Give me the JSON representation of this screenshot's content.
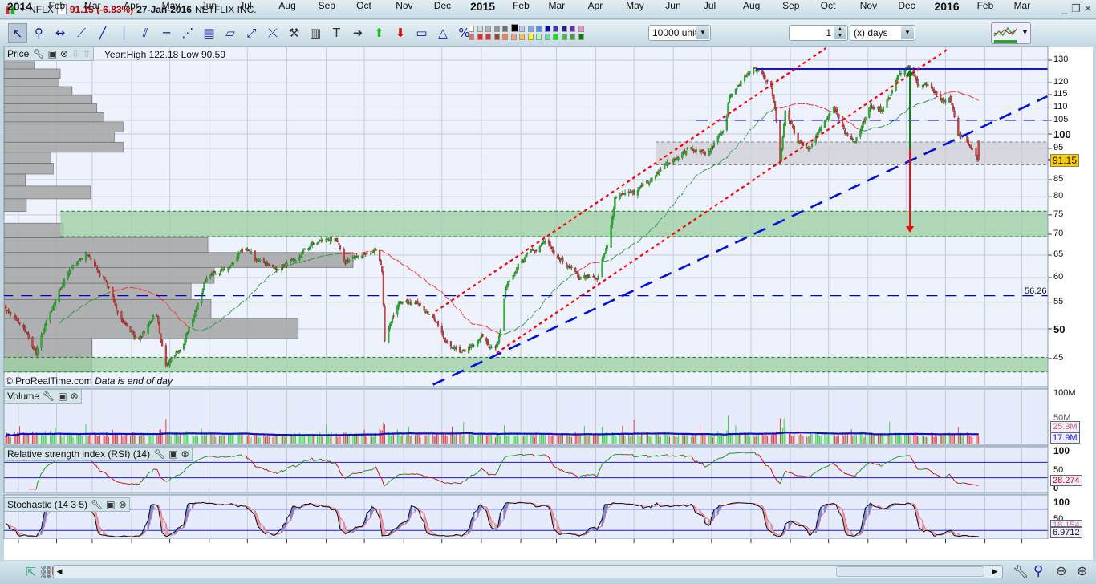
{
  "header": {
    "symbol": "NFLX",
    "price_change": "91.15 (-6.83%)",
    "date": "27-Jan-2016",
    "name": "NETFLIX INC."
  },
  "toolbar": {
    "tools": [
      [
        "pointer-icon",
        "↖"
      ],
      [
        "magnifier-icon",
        "⚲"
      ],
      [
        "horizontal-segment-icon",
        "↔"
      ],
      [
        "segment-icon",
        "⟋"
      ],
      [
        "line-icon",
        "╱"
      ],
      [
        "vertical-line-icon",
        "│"
      ],
      [
        "channel-icon",
        "⫽"
      ],
      [
        "horizontal-line-icon",
        "─"
      ],
      [
        "fan-icon",
        "⋰"
      ],
      [
        "fibonacci-icon",
        "▤"
      ],
      [
        "ruler-icon",
        "▱"
      ],
      [
        "point-line-icon",
        "⤢"
      ],
      [
        "cross-line-icon",
        "⤫"
      ],
      [
        "tools-icon",
        "⚒"
      ],
      [
        "trash-icon",
        "▥"
      ],
      [
        "text-icon",
        "T"
      ],
      [
        "arrow-right-icon",
        "➜"
      ],
      [
        "arrow-up-icon",
        "⬆"
      ],
      [
        "arrow-down-icon",
        "⬇"
      ],
      [
        "rectangle-icon",
        "▭"
      ],
      [
        "triangle-icon",
        "△"
      ],
      [
        "percent-icon",
        "%"
      ]
    ],
    "palette_top": [
      "#ffffff",
      "#d4d4d4",
      "#b4b4b4",
      "#949494",
      "#707070",
      "#000000",
      "#b8c8ff",
      "#80a8ff",
      "#4090ff",
      "#0000d0",
      "#3838b8",
      "#202090",
      "#8020c0",
      "#ff88c8"
    ],
    "palette_bottom": [
      "#e07070",
      "#ff2020",
      "#e03030",
      "#a04818",
      "#ff8040",
      "#ff9888",
      "#ffc040",
      "#ffff00",
      "#a8ffb0",
      "#60e0a0",
      "#00f000",
      "#40c040",
      "#40a040",
      "#008000"
    ],
    "units": "10000 units",
    "period_value": "1",
    "period_unit": "(x) days"
  },
  "price_panel": {
    "title": "Price",
    "info": "Year:High 122.18 Low 90.59",
    "copyright": "© ProRealTime.com",
    "disclaimer": "Data is end of day",
    "last_price_label": "91.15",
    "level_label": "56.26"
  },
  "volume_panel": {
    "title": "Volume",
    "ticks": [
      "100M",
      "50M"
    ],
    "last_label": "25.3M",
    "avg_label": "17.9M"
  },
  "rsi_panel": {
    "title": "Relative strength index (RSI) (14)",
    "ticks": [
      "100",
      "50",
      "0"
    ],
    "value_label": "28.274"
  },
  "stoch_panel": {
    "title": "Stochastic (14 3 5)",
    "ticks": [
      "100",
      "50"
    ],
    "k_label": "18.154",
    "d_label": "6.9712"
  },
  "colors": {
    "up": "#2fb52f",
    "down": "#c44848",
    "level": "#0000e0",
    "trend_red": "#ff0000",
    "zone_green": "#9fcfa6",
    "zone_grey": "#cfcfd4",
    "last_price_bg": "#ffcc00"
  },
  "chart_data": {
    "type": "candlestick",
    "symbol": "NFLX",
    "x_labels": [
      "2014",
      "Feb",
      "Mar",
      "Apr",
      "May",
      "Jun",
      "Jul",
      "Aug",
      "Sep",
      "Oct",
      "Nov",
      "Dec",
      "2015",
      "Feb",
      "Mar",
      "Apr",
      "May",
      "Jun",
      "Jul",
      "Aug",
      "Sep",
      "Oct",
      "Nov",
      "Dec",
      "2016",
      "Feb",
      "Mar"
    ],
    "y_ticks": [
      130,
      120,
      115,
      110,
      105,
      100,
      95,
      85,
      80,
      75,
      70,
      65,
      60,
      55,
      50,
      45
    ],
    "y_scale": "log",
    "ylim": [
      41,
      133
    ],
    "close_anchors": [
      [
        "2013-12-23",
        54
      ],
      [
        "2014-01-06",
        50
      ],
      [
        "2014-01-16",
        46
      ],
      [
        "2014-01-25",
        52
      ],
      [
        "2014-02-07",
        60
      ],
      [
        "2014-02-24",
        65
      ],
      [
        "2014-03-10",
        60
      ],
      [
        "2014-03-23",
        52
      ],
      [
        "2014-04-07",
        48
      ],
      [
        "2014-04-20",
        53
      ],
      [
        "2014-04-28",
        44
      ],
      [
        "2014-05-11",
        47
      ],
      [
        "2014-05-19",
        52
      ],
      [
        "2014-05-30",
        60
      ],
      [
        "2014-06-15",
        62
      ],
      [
        "2014-06-30",
        67
      ],
      [
        "2014-07-08",
        64
      ],
      [
        "2014-07-25",
        62
      ],
      [
        "2014-08-07",
        64
      ],
      [
        "2014-08-23",
        68
      ],
      [
        "2014-09-09",
        69
      ],
      [
        "2014-09-16",
        64
      ],
      [
        "2014-09-30",
        65
      ],
      [
        "2014-10-11",
        66
      ],
      [
        "2014-10-15",
        61
      ],
      [
        "2014-10-17",
        48
      ],
      [
        "2014-10-28",
        55
      ],
      [
        "2014-11-12",
        55
      ],
      [
        "2014-11-24",
        52
      ],
      [
        "2014-12-07",
        47
      ],
      [
        "2014-12-19",
        46
      ],
      [
        "2015-01-01",
        49
      ],
      [
        "2015-01-11",
        46
      ],
      [
        "2015-01-17",
        50
      ],
      [
        "2015-01-20",
        58
      ],
      [
        "2015-02-02",
        64
      ],
      [
        "2015-02-21",
        68
      ],
      [
        "2015-03-05",
        64
      ],
      [
        "2015-03-18",
        60
      ],
      [
        "2015-04-02",
        60
      ],
      [
        "2015-04-06",
        64
      ],
      [
        "2015-04-11",
        68
      ],
      [
        "2015-04-16",
        80
      ],
      [
        "2015-05-01",
        81
      ],
      [
        "2015-05-14",
        85
      ],
      [
        "2015-05-26",
        90
      ],
      [
        "2015-06-14",
        95
      ],
      [
        "2015-06-27",
        93
      ],
      [
        "2015-07-12",
        102
      ],
      [
        "2015-07-15",
        115
      ],
      [
        "2015-08-03",
        127
      ],
      [
        "2015-08-16",
        120
      ],
      [
        "2015-08-20",
        110
      ],
      [
        "2015-08-24",
        90
      ],
      [
        "2015-08-28",
        110
      ],
      [
        "2015-09-06",
        98
      ],
      [
        "2015-09-16",
        95
      ],
      [
        "2015-10-05",
        110
      ],
      [
        "2015-10-14",
        100
      ],
      [
        "2015-10-21",
        97
      ],
      [
        "2015-11-03",
        110
      ],
      [
        "2015-11-12",
        108
      ],
      [
        "2015-11-25",
        122
      ],
      [
        "2015-12-04",
        128
      ],
      [
        "2015-12-10",
        120
      ],
      [
        "2015-12-19",
        118
      ],
      [
        "2015-12-29",
        112
      ],
      [
        "2016-01-04",
        115
      ],
      [
        "2016-01-11",
        100
      ],
      [
        "2016-01-17",
        98
      ],
      [
        "2016-01-27",
        91.15
      ]
    ],
    "last": {
      "close": 91.15,
      "change_pct": -6.83,
      "low": 90.59
    },
    "volume_profile": [
      [
        126.0,
        129.3,
        8.6
      ],
      [
        121.9,
        126.0,
        16.1
      ],
      [
        118.3,
        121.9,
        15.7
      ],
      [
        114.7,
        118.3,
        19.5
      ],
      [
        111.3,
        114.7,
        25.2
      ],
      [
        107.9,
        111.3,
        26.6
      ],
      [
        104.4,
        107.9,
        28.6
      ],
      [
        100.7,
        104.4,
        34.1
      ],
      [
        97.1,
        100.7,
        31.6
      ],
      [
        93.7,
        97.1,
        34.1
      ],
      [
        90.1,
        93.7,
        13.4
      ],
      [
        86.7,
        90.1,
        14.1
      ],
      [
        83.1,
        86.7,
        6.1
      ],
      [
        79.4,
        83.1,
        24.8
      ],
      [
        75.9,
        79.4,
        6.4
      ],
      [
        69.1,
        72.8,
        17
      ],
      [
        65.6,
        69.1,
        58.4
      ],
      [
        62.2,
        65.6,
        100
      ],
      [
        58.8,
        62.2,
        60.2
      ],
      [
        55.5,
        58.8,
        53.6
      ],
      [
        51.9,
        55.5,
        59.3
      ],
      [
        48.3,
        51.9,
        84.3
      ],
      [
        42.9,
        48.3,
        25.2
      ]
    ],
    "zones": [
      {
        "kind": "green",
        "from": "2014-02-04",
        "low": 69.4,
        "high": 76.0
      },
      {
        "kind": "green",
        "from": "2013-12-20",
        "low": 42.9,
        "high": 45.2
      },
      {
        "kind": "grey",
        "from": "2015-05-18",
        "low": 89.6,
        "high": 97.2
      }
    ],
    "levels": [
      {
        "style": "solid",
        "price": 126,
        "from": "2015-08-05"
      },
      {
        "style": "dashed",
        "price": 105,
        "from": "2015-06-19"
      },
      {
        "style": "dashed",
        "price": 56.26,
        "from": "2013-12-20"
      }
    ],
    "trendlines": [
      {
        "color": "red",
        "from": [
          "2014-11-26",
          53.2
        ],
        "to": [
          "2015-09-29",
          135.7
        ]
      },
      {
        "color": "red",
        "from": [
          "2015-01-13",
          45.9
        ],
        "to": [
          "2016-01-02",
          134.9
        ]
      },
      {
        "color": "blue",
        "from": [
          "2014-11-24",
          41.0
        ],
        "to": [
          "2016-03-21",
          114.3
        ]
      }
    ],
    "arrow": {
      "date": "2015-12-04",
      "start": 125.8,
      "mid": 94.6,
      "end": 70.4
    },
    "volume_ylim": [
      0,
      100
    ],
    "rsi_levels": [
      70,
      30
    ],
    "stoch_levels": [
      80,
      20
    ]
  }
}
